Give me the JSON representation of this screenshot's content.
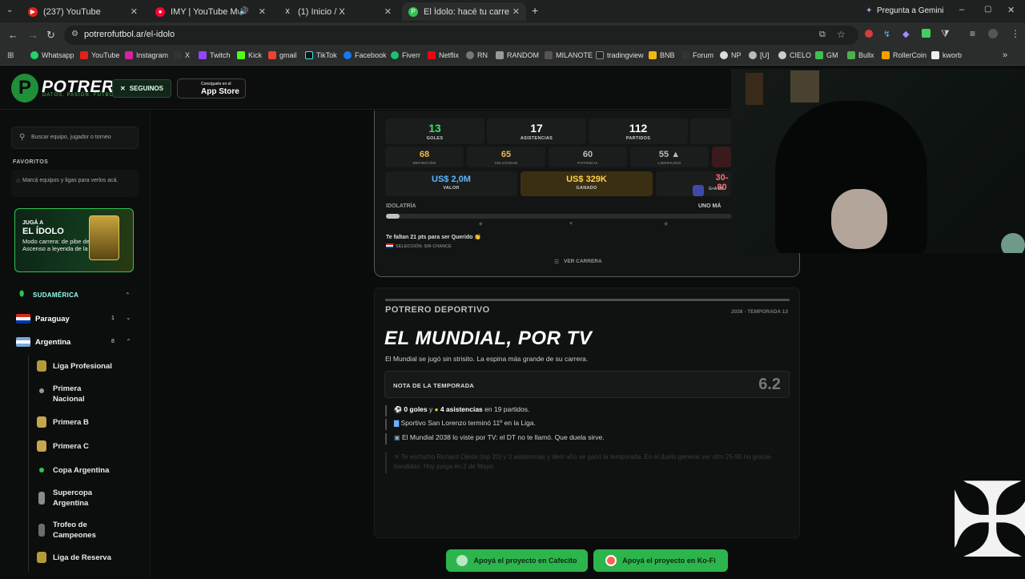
{
  "browser": {
    "tabs": [
      {
        "title": "(237) YouTube",
        "fav_color": "#e62117",
        "active": false
      },
      {
        "title": "IMY | YouTube Music",
        "fav_color": "#ff0033",
        "active": false
      },
      {
        "title": "(1) Inicio / X",
        "fav_color": "#222222",
        "active": false
      },
      {
        "title": "El Ídolo: hacé tu carrera en la Liga",
        "fav_color": "#2fc552",
        "active": true
      }
    ],
    "gemini_label": "Pregunta a Gemini",
    "url": "potrerofutbol.ar/el-idolo",
    "bookmarks": [
      "Whatsapp",
      "YouTube",
      "Instagram",
      "X",
      "Twitch",
      "Kick",
      "gmail",
      "TikTok",
      "Facebook",
      "Fiverr",
      "Netflix",
      "RN",
      "RANDOM",
      "MILANOTE",
      "tradingview",
      "BNB",
      "Forum",
      "NP",
      "[U]",
      "CIELO",
      "GM",
      "Bullx",
      "RollerCoin",
      "kworb"
    ]
  },
  "header": {
    "logo_word": "POTRERO",
    "logo_tagline": "DATOS. PASIÓN. FÚTBOL.",
    "follow_label": "SEGUINOS",
    "appstore_small": "Consíguelo en el",
    "appstore_big": "App Store"
  },
  "sidebar": {
    "search_placeholder": "Buscar equipo, jugador o torneo",
    "favorites_title": "FAVORITOS",
    "favorites_empty": "Marcá equipos y ligas para verlos acá.",
    "promo": {
      "kicker": "JUGÁ A",
      "title": "EL ÍDOLO",
      "desc": "Modo carrera: de pibe del Ascenso a leyenda de la Liga"
    },
    "region": "SUDAMÉRICA",
    "countries": [
      {
        "name": "Paraguay",
        "count": "1"
      },
      {
        "name": "Argentina",
        "count": "8"
      }
    ],
    "leagues": [
      "Liga Profesional",
      "Primera Nacional",
      "Primera B",
      "Primera C",
      "Copa Argentina",
      "Supercopa Argentina",
      "Trofeo de Campeones",
      "Liga de Reserva"
    ]
  },
  "career": {
    "stats": [
      {
        "value": "13",
        "label": "GOLES",
        "color": "#3fe060"
      },
      {
        "value": "17",
        "label": "ASISTENCIAS",
        "color": "#ffffff"
      },
      {
        "value": "112",
        "label": "PARTIDOS",
        "color": "#ffffff"
      }
    ],
    "attributes": [
      {
        "value": "68",
        "label": "DEFINICIÓN",
        "color": "#f2b84a"
      },
      {
        "value": "65",
        "label": "VELOCIDAD",
        "color": "#f2b84a"
      },
      {
        "value": "60",
        "label": "POTENCIA",
        "color": "#bbbbbb"
      },
      {
        "value": "55 ▲",
        "label": "LIDERAZGO",
        "color": "#bbbbbb"
      }
    ],
    "value_label": "VALOR",
    "value_amount": "US$ 2,0M",
    "earned_label": "GANADO",
    "earned_amount": "US$ 329K",
    "partial": "30-80",
    "partial_sub": "G+A VS",
    "idolatry_label": "IDOLATRÍA",
    "idolatry_fill": 0.04,
    "next_label": "UNO MÁ",
    "missing_text": "Te faltan 21 pts para ser Querido 👏",
    "selection_text": "SELECCIÓN: SIN CHANCE",
    "career_link": "VER CARRERA"
  },
  "season": {
    "brand": "POTRERO DEPORTIVO",
    "meta": "2038 · TEMPORADA 13",
    "headline": "EL MUNDIAL, POR TV",
    "subline": "El Mundial se jugó sin strisito. La espina más grande de su carrera.",
    "rating_label": "NOTA DE LA TEMPORADA",
    "rating_value": "6.2",
    "b1_goals": "0 goles",
    "b1_mid": " y ",
    "b1_assists": "4 asistencias",
    "b1_end": " en 19 partidos.",
    "b2": "Sportivo San Lorenzo terminó 11º en la Liga.",
    "b3": "El Mundial 2038 lo viste por TV: el DT no te llamó. Que duela sirve.",
    "b4": "Te eschichó Richard Ojeda (top 20) y 3 asistencias y dem año se ganó la temporada. En el duelo generar ver otro 25-90 no gracia-bandidas. Hoy juega en 2 de Mayo."
  },
  "donate": {
    "cafecito": "Apoyá el proyecto en Cafecito",
    "kofi": "Apoyá el proyecto en Ko-Fi"
  }
}
